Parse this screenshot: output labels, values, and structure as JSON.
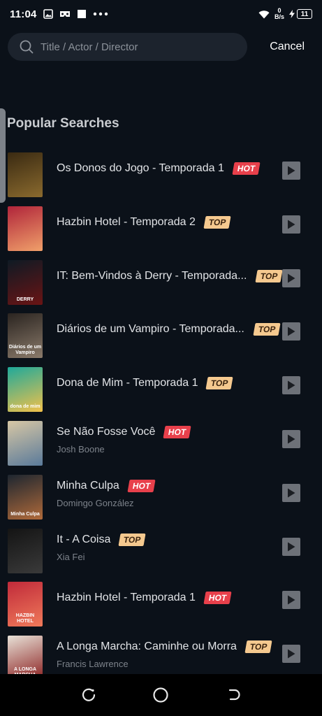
{
  "status_bar": {
    "time": "11:04",
    "net_speed_value": "0",
    "net_speed_unit": "B/s",
    "battery_level": "11"
  },
  "search": {
    "placeholder": "Title / Actor / Director",
    "cancel_label": "Cancel"
  },
  "section_title": "Popular Searches",
  "items": [
    {
      "title": "Os Donos do Jogo - Temporada 1",
      "badge": "HOT",
      "badge_type": "hot",
      "subtitle": "",
      "poster_colors": [
        "#3a2a12",
        "#8a6a2e"
      ]
    },
    {
      "title": "Hazbin Hotel - Temporada 2",
      "badge": "TOP",
      "badge_type": "top",
      "subtitle": "",
      "poster_colors": [
        "#b0243a",
        "#f0a06a"
      ]
    },
    {
      "title": "IT: Bem-Vindos à Derry - Temporada...",
      "badge": "TOP",
      "badge_type": "top",
      "subtitle": "",
      "poster_colors": [
        "#0e1a24",
        "#6a1414"
      ],
      "poster_text": "DERRY"
    },
    {
      "title": "Diários de um Vampiro - Temporada...",
      "badge": "TOP",
      "badge_type": "top",
      "subtitle": "",
      "poster_colors": [
        "#2a2420",
        "#8a7a6a"
      ],
      "poster_text": "Diários de um Vampiro"
    },
    {
      "title": "Dona de Mim - Temporada 1",
      "badge": "TOP",
      "badge_type": "top",
      "subtitle": "",
      "poster_colors": [
        "#1fa99a",
        "#f2c14a"
      ],
      "poster_text": "dona de mim"
    },
    {
      "title": "Se Não Fosse Você",
      "badge": "HOT",
      "badge_type": "hot",
      "subtitle": "Josh Boone",
      "poster_colors": [
        "#d7c7a5",
        "#5a7a9a"
      ]
    },
    {
      "title": "Minha Culpa",
      "badge": "HOT",
      "badge_type": "hot",
      "subtitle": "Domingo González",
      "poster_colors": [
        "#1d2630",
        "#b06a3a"
      ],
      "poster_text": "Minha Culpa"
    },
    {
      "title": "It - A Coisa",
      "badge": "TOP",
      "badge_type": "top",
      "subtitle": "Xia Fei",
      "poster_colors": [
        "#141414",
        "#3a3a3a"
      ]
    },
    {
      "title": "Hazbin Hotel - Temporada 1",
      "badge": "HOT",
      "badge_type": "hot",
      "subtitle": "",
      "poster_colors": [
        "#c02a3a",
        "#f07a5a"
      ],
      "poster_text": "HAZBIN HOTEL"
    },
    {
      "title": "A Longa Marcha: Caminhe ou Morra",
      "badge": "TOP",
      "badge_type": "top",
      "subtitle": "Francis Lawrence",
      "poster_colors": [
        "#e8e2d8",
        "#8a1f1f"
      ],
      "poster_text": "A LONGA MARCHA"
    }
  ],
  "colors": {
    "background": "#0b1119",
    "search_bg": "#1c232d",
    "hot_badge": "#e8404b",
    "top_badge": "#f5c98f",
    "play_button": "#6d7178"
  },
  "nav": {
    "back_icon": "recent-apps-icon",
    "home_icon": "home-circle-icon",
    "return_icon": "back-arrow-icon"
  }
}
